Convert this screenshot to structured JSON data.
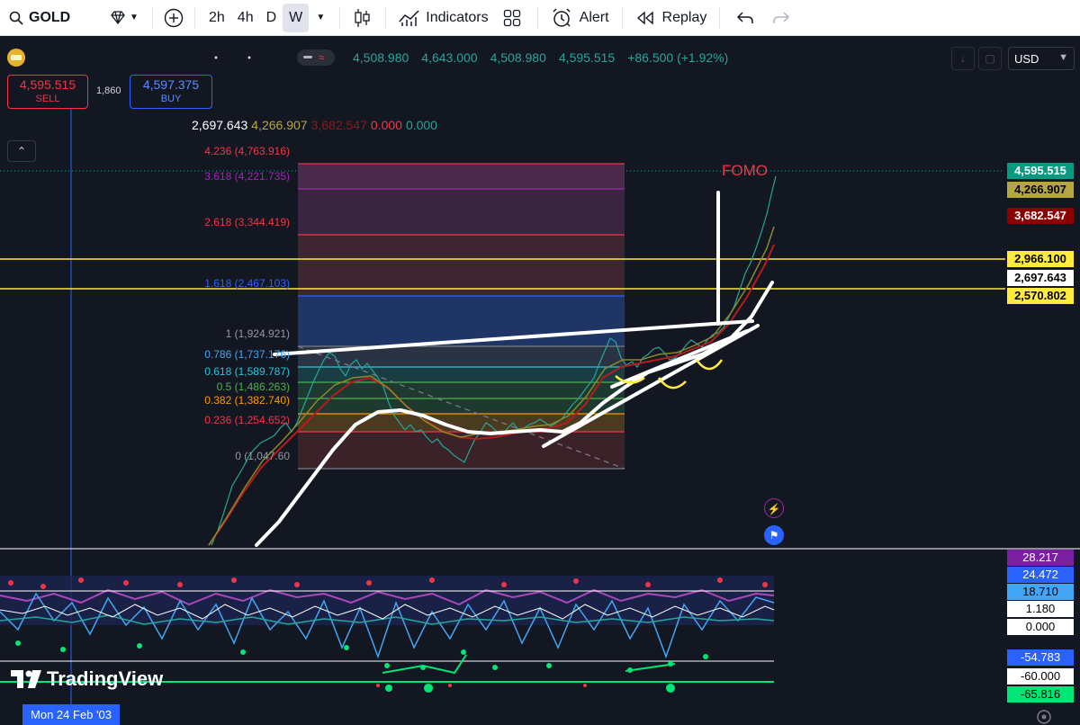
{
  "toolbar": {
    "symbol": "GOLD",
    "intervals": [
      "2h",
      "4h",
      "D",
      "W"
    ],
    "active_interval": "W",
    "indicators_label": "Indicators",
    "alert_label": "Alert",
    "replay_label": "Replay"
  },
  "trade": {
    "sell_price": "4,595.515",
    "sell_label": "SELL",
    "spread": "1,860",
    "buy_price": "4,597.375",
    "buy_label": "BUY"
  },
  "ohlc": {
    "open": "4,508.980",
    "high": "4,643.000",
    "low": "4,508.980",
    "close": "4,595.515",
    "change": "+86.500 (+1.92%)"
  },
  "currency": "USD",
  "indicator_values": [
    {
      "text": "2,697.643",
      "color": "#ffffff"
    },
    {
      "text": "4,266.907",
      "color": "#b5a642"
    },
    {
      "text": "3,682.547",
      "color": "#8b1a1a"
    },
    {
      "text": "0.000",
      "color": "#f23645"
    },
    {
      "text": "0.000",
      "color": "#26a69a"
    }
  ],
  "fib_levels": [
    {
      "label": "4.236 (4,763.916)",
      "color": "#f23645"
    },
    {
      "label": "3.618 (4,221.735)",
      "color": "#9c27b0"
    },
    {
      "label": "2.618 (3,344.419)",
      "color": "#f23645"
    },
    {
      "label": "1.618 (2,467.103)",
      "color": "#2962ff"
    },
    {
      "label": "1 (1,924.921)",
      "color": "#787b86"
    },
    {
      "label": "0.786 (1,737.176)",
      "color": "#42a5f5"
    },
    {
      "label": "0.618 (1,589.787)",
      "color": "#26c6da"
    },
    {
      "label": "0.5 (1,486.263)",
      "color": "#4caf50"
    },
    {
      "label": "0.382 (1,382.740)",
      "color": "#ff9800"
    },
    {
      "label": "0.236 (1,254.652)",
      "color": "#f23645"
    },
    {
      "label": "0 (1,047.60",
      "color": "#787b86"
    }
  ],
  "price_scale": [
    {
      "value": "4,595.515",
      "bg": "#089981",
      "fg": "#ffffff"
    },
    {
      "value": "4,266.907",
      "bg": "#b5a642",
      "fg": "#000000"
    },
    {
      "value": "3,682.547",
      "bg": "#8b0000",
      "fg": "#ffffff"
    },
    {
      "value": "2,966.100",
      "bg": "#ffeb3b",
      "fg": "#000000"
    },
    {
      "value": "2,697.643",
      "bg": "#ffffff",
      "fg": "#000000"
    },
    {
      "value": "2,570.802",
      "bg": "#ffeb3b",
      "fg": "#000000"
    }
  ],
  "osc_scale": [
    {
      "value": "28.217",
      "bg": "#7b1fa2",
      "fg": "#ffffff"
    },
    {
      "value": "24.472",
      "bg": "#2962ff",
      "fg": "#ffffff"
    },
    {
      "value": "18.710",
      "bg": "#42a5f5",
      "fg": "#000000"
    },
    {
      "value": "1.180",
      "bg": "#ffffff",
      "fg": "#000000"
    },
    {
      "value": "0.000",
      "bg": "#ffffff",
      "fg": "#000000"
    },
    {
      "value": "-54.783",
      "bg": "#2962ff",
      "fg": "#ffffff"
    },
    {
      "value": "-60.000",
      "bg": "#ffffff",
      "fg": "#000000"
    },
    {
      "value": "-65.816",
      "bg": "#00e676",
      "fg": "#000000"
    }
  ],
  "annotation": "FOMO",
  "crosshair_date": "Mon 24 Feb '03",
  "brand": "TradingView"
}
